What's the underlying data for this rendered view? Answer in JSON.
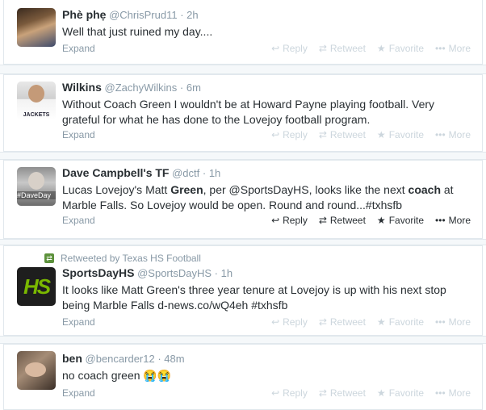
{
  "tweets": [
    {
      "fullname": "Phè phẹ",
      "username": "@ChrisPrud11",
      "time": "· 2h",
      "text": "Well that just ruined my day....",
      "expand": "Expand",
      "actions": {
        "reply": "Reply",
        "retweet": "Retweet",
        "favorite": "Favorite",
        "more": "More"
      }
    },
    {
      "fullname": "Wilkins",
      "username": "@ZachyWilkins",
      "time": "· 6m",
      "text": "Without Coach Green I wouldn't be at Howard Payne playing football. Very grateful for what he has done to the Lovejoy football program.",
      "avatar_text": "JACKETS",
      "expand": "Expand",
      "actions": {
        "reply": "Reply",
        "retweet": "Retweet",
        "favorite": "Favorite",
        "more": "More"
      }
    },
    {
      "fullname": "Dave Campbell's TF",
      "username": "@dctf",
      "time": "· 1h",
      "text_parts": [
        "Lucas Lovejoy's Matt ",
        "Green",
        ", per @SportsDayHS, looks like the next ",
        "coach",
        " at Marble Falls. So Lovejoy would be open. Round and round...#txhsfb"
      ],
      "avatar_text": "#DaveDay",
      "expand": "Expand",
      "actions": {
        "reply": "Reply",
        "retweet": "Retweet",
        "favorite": "Favorite",
        "more": "More"
      }
    },
    {
      "context": "Retweeted by Texas HS Football",
      "fullname": "SportsDayHS",
      "username": "@SportsDayHS",
      "time": "· 1h",
      "text": "It looks like Matt Green's three year tenure at Lovejoy is up with his next stop being Marble Falls d-news.co/wQ4eh  #txhsfb",
      "avatar_text": "HS",
      "expand": "Expand",
      "actions": {
        "reply": "Reply",
        "retweet": "Retweet",
        "favorite": "Favorite",
        "more": "More"
      }
    },
    {
      "fullname": "ben",
      "username": "@bencarder12",
      "time": "· 48m",
      "text": "no coach green 😭😭",
      "expand": "Expand",
      "actions": {
        "reply": "Reply",
        "retweet": "Retweet",
        "favorite": "Favorite",
        "more": "More"
      }
    }
  ],
  "icons": {
    "reply": "reply-arrow",
    "retweet": "retweet-arrows",
    "favorite": "star",
    "more": "ellipsis"
  },
  "colors": {
    "muted": "#8899a6",
    "faint": "#ccd6dd",
    "text": "#292f33",
    "retweet_badge": "#5c913b",
    "hs_green": "#7ab800"
  }
}
